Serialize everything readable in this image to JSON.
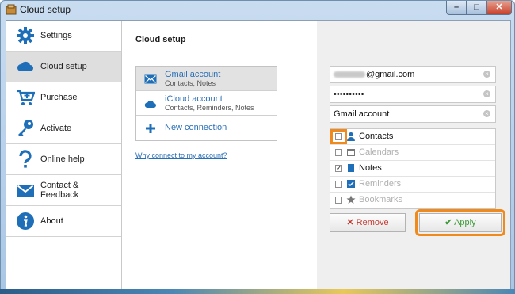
{
  "window": {
    "title": "Cloud setup",
    "minimize_glyph": "–",
    "maximize_glyph": "□",
    "close_glyph": "✕"
  },
  "sidebar": {
    "items": [
      {
        "label": "Settings",
        "icon": "gear-icon",
        "active": false
      },
      {
        "label": "Cloud setup",
        "icon": "cloud-icon",
        "active": true
      },
      {
        "label": "Purchase",
        "icon": "cart-icon",
        "active": false
      },
      {
        "label": "Activate",
        "icon": "key-icon",
        "active": false
      },
      {
        "label": "Online help",
        "icon": "question-icon",
        "active": false
      },
      {
        "label": "Contact & Feedback",
        "icon": "envelope-icon",
        "active": false
      },
      {
        "label": "About",
        "icon": "info-icon",
        "active": false
      }
    ]
  },
  "main": {
    "heading": "Cloud setup",
    "accounts": [
      {
        "title": "Gmail account",
        "subtitle": "Contacts, Notes",
        "icon": "mail-icon",
        "selected": true
      },
      {
        "title": "iCloud account",
        "subtitle": "Contacts, Reminders, Notes",
        "icon": "cloud-icon",
        "selected": false
      }
    ],
    "new_connection": "New connection",
    "why_link": "Why connect to my account?"
  },
  "panel": {
    "email_suffix": "@gmail.com",
    "password_mask": "••••••••••",
    "account_name": "Gmail account",
    "options": [
      {
        "label": "Contacts",
        "checked": false,
        "enabled": true,
        "icon": "person-icon"
      },
      {
        "label": "Calendars",
        "checked": false,
        "enabled": false,
        "icon": "calendar-icon"
      },
      {
        "label": "Notes",
        "checked": true,
        "enabled": true,
        "icon": "notebook-icon"
      },
      {
        "label": "Reminders",
        "checked": false,
        "enabled": false,
        "icon": "reminder-icon"
      },
      {
        "label": "Bookmarks",
        "checked": false,
        "enabled": false,
        "icon": "star-icon"
      }
    ],
    "remove_label": "Remove",
    "apply_label": "Apply"
  },
  "colors": {
    "accent_blue": "#2a6fb6",
    "highlight_orange": "#f08a1d",
    "remove_red": "#c43a31",
    "apply_green": "#3e9b3a"
  }
}
